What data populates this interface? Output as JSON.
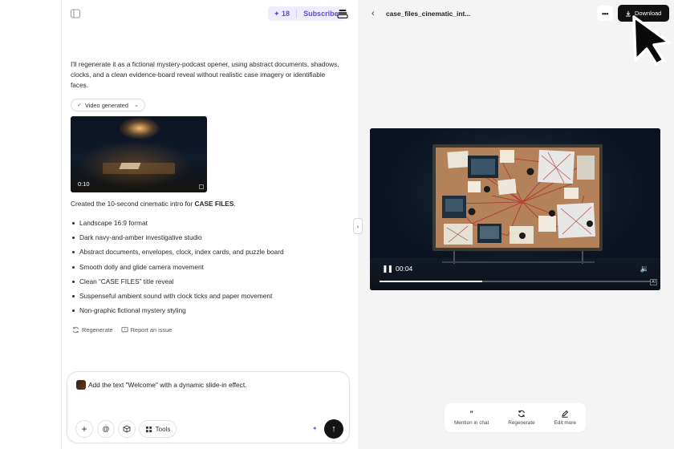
{
  "left_panel": {
    "credits": "18",
    "subscribe_label": "Subscribe",
    "assistant_message": "I'll regenerate it as a fictional mystery-podcast opener, using abstract documents, shadows, clocks, and a clean evidence-board reveal without realistic case imagery or identifiable faces.",
    "video_badge": "Video generated",
    "thumbnail_duration": "0:10",
    "created_prefix": "Created the 10-second cinematic intro for ",
    "created_strong": "CASE FILES",
    "created_suffix": ".",
    "features": [
      "Landscape 16:9 format",
      "Dark navy-and-amber investigative studio",
      "Abstract documents, envelopes, clock, index cards, and puzzle board",
      "Smooth dolly and glide camera movement",
      "Clean “CASE FILES” title reveal",
      "Suspenseful ambient sound with clock ticks and paper movement",
      "Non-graphic fictional mystery styling"
    ],
    "regenerate_label": "Regenerate",
    "report_label": "Report an issue",
    "composer": {
      "input_value": "Add the text \"Welcome\" with a dynamic slide-in effect.",
      "tools_label": "Tools"
    }
  },
  "right_panel": {
    "file_title": "case_files_cinematic_int...",
    "download_label": "Download",
    "player": {
      "current_time": "00:04",
      "progress": 0.38,
      "ai_badge": "AI"
    },
    "toolbar": [
      {
        "icon": "quote-icon",
        "label": "Mention in chat"
      },
      {
        "icon": "refresh-icon",
        "label": "Regenerate"
      },
      {
        "icon": "pen-icon",
        "label": "Edit more"
      }
    ]
  }
}
